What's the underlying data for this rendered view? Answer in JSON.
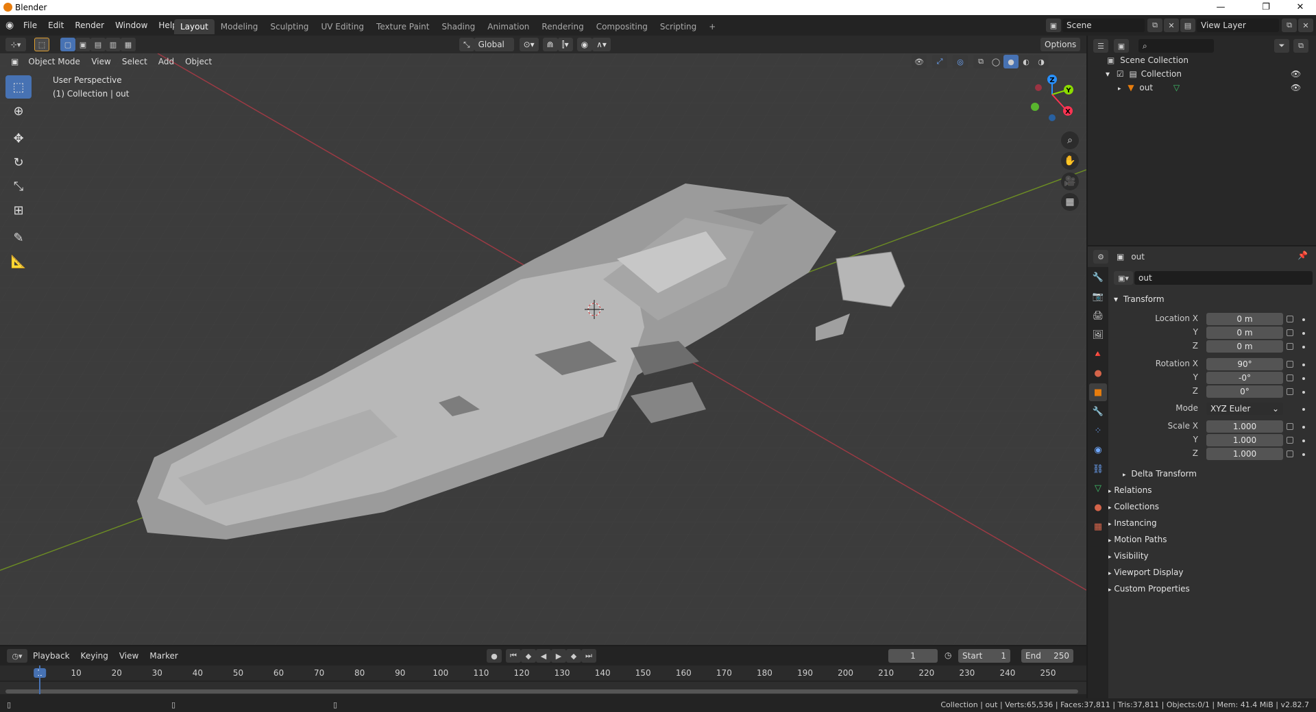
{
  "window": {
    "title": "Blender"
  },
  "menus": [
    "File",
    "Edit",
    "Render",
    "Window",
    "Help"
  ],
  "workspaces": [
    "Layout",
    "Modeling",
    "Sculpting",
    "UV Editing",
    "Texture Paint",
    "Shading",
    "Animation",
    "Rendering",
    "Compositing",
    "Scripting",
    "+"
  ],
  "active_workspace": "Layout",
  "scene": {
    "label": "Scene",
    "view_layer": "View Layer"
  },
  "viewport_header": {
    "orientation": "Global",
    "options": "Options",
    "mode": "Object Mode",
    "menus": [
      "View",
      "Select",
      "Add",
      "Object"
    ]
  },
  "viewport": {
    "perspective": "User Perspective",
    "collection_info": "(1) Collection | out",
    "gizmo": {
      "z": "Z",
      "y": "Y",
      "x": "X"
    }
  },
  "outliner": {
    "search_placeholder": "",
    "scene_collection": "Scene Collection",
    "collection": "Collection",
    "object": "out"
  },
  "properties": {
    "header_object": "out",
    "object_name": "out",
    "transform_title": "Transform",
    "location": {
      "label": "Location X",
      "x": "0 m",
      "y": "0 m",
      "z": "0 m"
    },
    "rotation": {
      "label": "Rotation X",
      "x": "90°",
      "y": "-0°",
      "z": "0°"
    },
    "mode": {
      "label": "Mode",
      "value": "XYZ Euler"
    },
    "scale": {
      "label": "Scale X",
      "x": "1.000",
      "y": "1.000",
      "z": "1.000"
    },
    "axis_y": "Y",
    "axis_z": "Z",
    "delta": "Delta Transform",
    "panels": [
      "Relations",
      "Collections",
      "Instancing",
      "Motion Paths",
      "Visibility",
      "Viewport Display",
      "Custom Properties"
    ]
  },
  "timeline": {
    "menus": [
      "Playback",
      "Keying",
      "View",
      "Marker"
    ],
    "current_frame": "1",
    "start_label": "Start",
    "start": "1",
    "end_label": "End",
    "end": "250",
    "ticks": [
      "1",
      "10",
      "20",
      "30",
      "40",
      "50",
      "60",
      "70",
      "80",
      "90",
      "100",
      "110",
      "120",
      "130",
      "140",
      "150",
      "160",
      "170",
      "180",
      "190",
      "200",
      "210",
      "220",
      "230",
      "240",
      "250"
    ]
  },
  "status": {
    "text": "Collection | out | Verts:65,536 | Faces:37,811 | Tris:37,811 | Objects:0/1 | Mem: 41.4 MiB | v2.82.7"
  },
  "colors": {
    "accent": "#4772b3",
    "x_axis": "#ff3352",
    "y_axis": "#8bdc00",
    "z_axis": "#2890ff",
    "object_orange": "#e87d0d"
  }
}
